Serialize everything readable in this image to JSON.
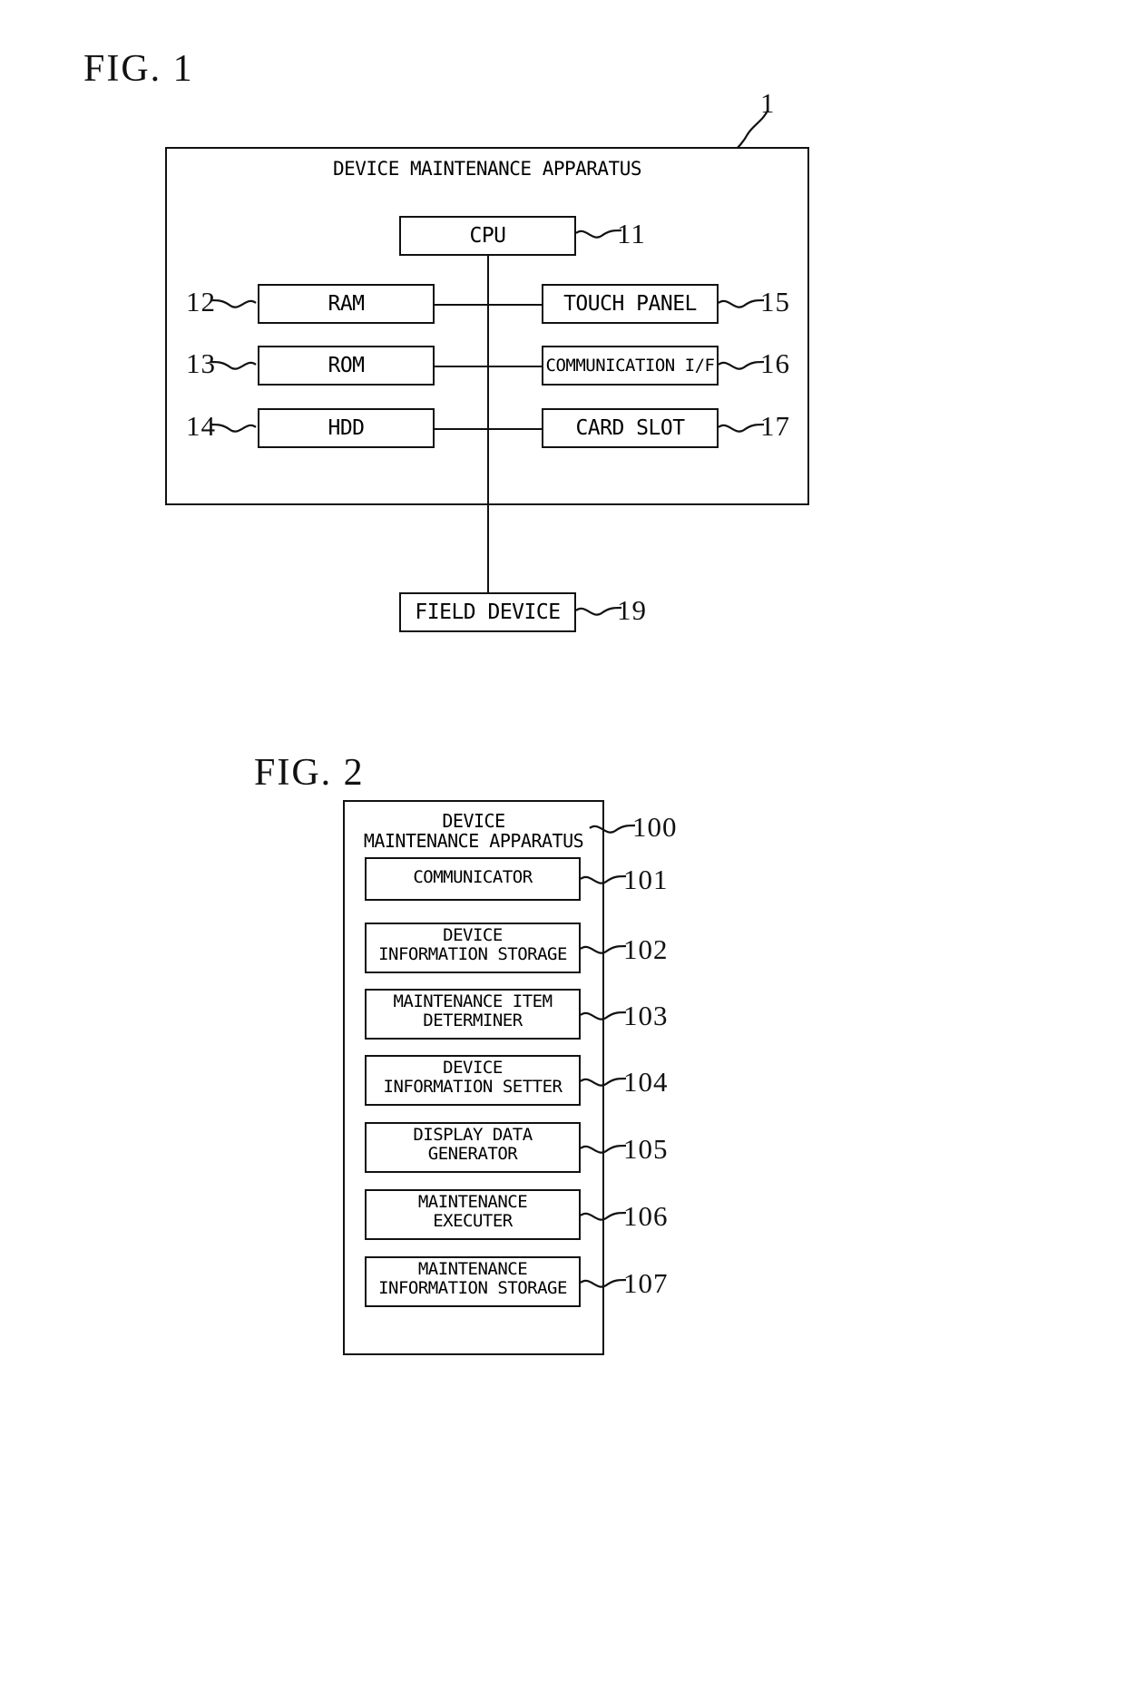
{
  "document": {
    "type": "patent-figure-sheet",
    "figures": [
      {
        "id": "fig1",
        "title": "FIG. 1",
        "outer_box": {
          "label": "DEVICE MAINTENANCE APPARATUS",
          "ref": "1"
        },
        "blocks": [
          {
            "label": "CPU",
            "ref": "11",
            "column": "center"
          },
          {
            "label": "RAM",
            "ref": "12",
            "column": "left"
          },
          {
            "label": "ROM",
            "ref": "13",
            "column": "left"
          },
          {
            "label": "HDD",
            "ref": "14",
            "column": "left"
          },
          {
            "label": "TOUCH PANEL",
            "ref": "15",
            "column": "right"
          },
          {
            "label": "COMMUNICATION I/F",
            "ref": "16",
            "column": "right"
          },
          {
            "label": "CARD SLOT",
            "ref": "17",
            "column": "right"
          }
        ],
        "external": [
          {
            "label": "FIELD DEVICE",
            "ref": "19"
          }
        ]
      },
      {
        "id": "fig2",
        "title": "FIG. 2",
        "outer_box": {
          "label": "DEVICE\nMAINTENANCE APPARATUS",
          "ref": "100"
        },
        "blocks": [
          {
            "label": "COMMUNICATOR",
            "ref": "101"
          },
          {
            "label": "DEVICE\nINFORMATION STORAGE",
            "ref": "102"
          },
          {
            "label": "MAINTENANCE ITEM\nDETERMINER",
            "ref": "103"
          },
          {
            "label": "DEVICE\nINFORMATION SETTER",
            "ref": "104"
          },
          {
            "label": "DISPLAY DATA\nGENERATOR",
            "ref": "105"
          },
          {
            "label": "MAINTENANCE\nEXECUTER",
            "ref": "106"
          },
          {
            "label": "MAINTENANCE\nINFORMATION STORAGE",
            "ref": "107"
          }
        ]
      }
    ],
    "colors": {
      "ink": "#111111",
      "paper": "#ffffff"
    }
  }
}
